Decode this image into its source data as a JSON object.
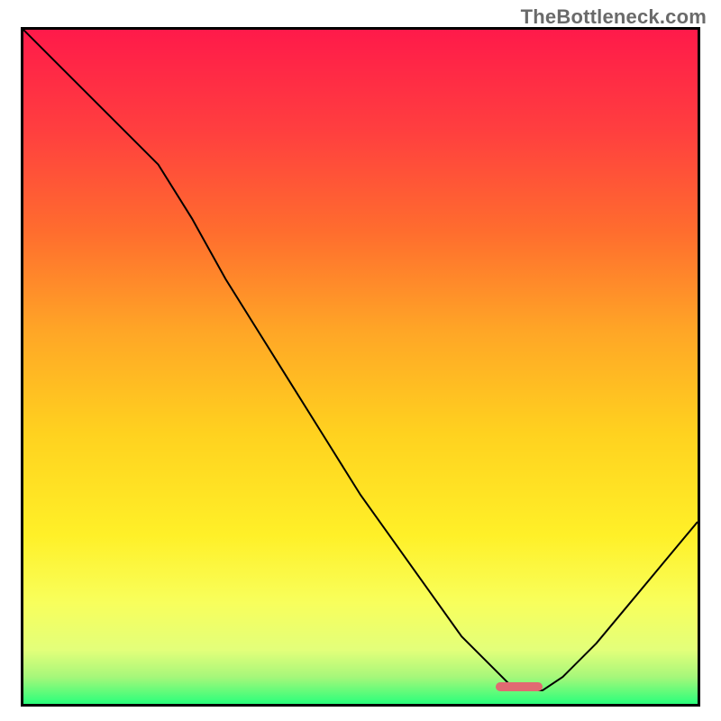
{
  "watermark": "TheBottleneck.com",
  "frame": {
    "border_color": "#000000",
    "border_width_px": 3
  },
  "gradient": {
    "stops": [
      {
        "offset": 0.0,
        "color": "#ff1a4a"
      },
      {
        "offset": 0.15,
        "color": "#ff3f3f"
      },
      {
        "offset": 0.3,
        "color": "#ff6d2e"
      },
      {
        "offset": 0.45,
        "color": "#ffa726"
      },
      {
        "offset": 0.6,
        "color": "#ffd21f"
      },
      {
        "offset": 0.75,
        "color": "#fff028"
      },
      {
        "offset": 0.85,
        "color": "#f8ff5c"
      },
      {
        "offset": 0.92,
        "color": "#e3ff7a"
      },
      {
        "offset": 0.96,
        "color": "#a6f77a"
      },
      {
        "offset": 1.0,
        "color": "#2aff7b"
      }
    ]
  },
  "marker": {
    "color": "#e16a72",
    "x_frac": 0.735,
    "width_frac": 0.07,
    "y_frac": 0.975
  },
  "chart_data": {
    "type": "line",
    "title": "",
    "xlabel": "",
    "ylabel": "",
    "xlim": [
      0,
      100
    ],
    "ylim": [
      0,
      100
    ],
    "note": "Axes are unlabeled normalized 0–100; y=100 is the top (red zone), y=0 is the bottom (green zone). Curve values estimated from pixel positions.",
    "x": [
      0,
      5,
      10,
      15,
      20,
      25,
      30,
      35,
      40,
      45,
      50,
      55,
      60,
      65,
      70,
      73,
      77,
      80,
      85,
      90,
      95,
      100
    ],
    "y": [
      100,
      95,
      90,
      85,
      80,
      72,
      63,
      55,
      47,
      39,
      31,
      24,
      17,
      10,
      5,
      2,
      2,
      4,
      9,
      15,
      21,
      27
    ],
    "minimum_band": {
      "x_start": 72,
      "x_end": 78,
      "y": 2
    }
  }
}
